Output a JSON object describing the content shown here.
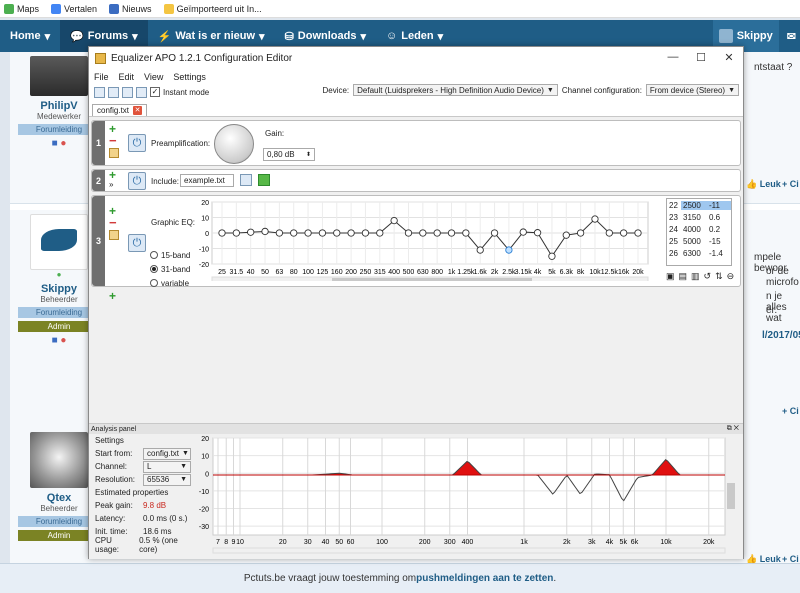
{
  "bookmarks": [
    "Maps",
    "Vertalen",
    "Nieuws",
    "Geïmporteerd uit In..."
  ],
  "forum_nav": {
    "items": [
      "Home",
      "Forums",
      "Wat is er nieuw",
      "Downloads",
      "Leden"
    ],
    "user": "Skippy"
  },
  "posts": [
    {
      "name": "PhilipV",
      "role": "Medewerker",
      "badge": "Forumleiding"
    },
    {
      "name": "Skippy",
      "role": "Beheerder",
      "badge1": "Forumleiding",
      "badge2": "Admin"
    },
    {
      "name": "Qtex",
      "role": "Beheerder",
      "badge1": "Forumleiding",
      "badge2": "Admin"
    }
  ],
  "right_snippets": [
    "ntstaat ?",
    "Leuk",
    "+ Ci",
    "mpele bewoor",
    "or de microfo",
    "n je alles wat",
    "er.",
    "l/2017/05/2",
    "+ Ci",
    "Leuk",
    "+ Ci"
  ],
  "notification": {
    "text": "Pctuts.be vraagt jouw toestemming om ",
    "link": "pushmeldingen aan te zetten",
    "end": " ."
  },
  "window": {
    "title": "Equalizer APO 1.2.1 Configuration Editor",
    "menu": [
      "File",
      "Edit",
      "View",
      "Settings"
    ],
    "instant_mode": "Instant mode",
    "device_label": "Device:",
    "device_value": "Default (Luidsprekers - High Definition Audio Device)",
    "channel_label": "Channel configuration:",
    "channel_value": "From device (Stereo)",
    "tab": "config.txt"
  },
  "blocks": {
    "b1": {
      "num": "1",
      "label": "Preamplification:",
      "gain_label": "Gain:",
      "gain_value": "0,80 dB"
    },
    "b2": {
      "num": "2",
      "label": "Include:",
      "include_value": "example.txt"
    },
    "b3": {
      "num": "3",
      "label": "Graphic EQ:",
      "r15": "15-band",
      "r31": "31-band",
      "rvar": "variable"
    }
  },
  "eq_table": [
    {
      "i": "22",
      "f": "2500",
      "g": "-11"
    },
    {
      "i": "23",
      "f": "3150",
      "g": "0.6"
    },
    {
      "i": "24",
      "f": "4000",
      "g": "0.2"
    },
    {
      "i": "25",
      "f": "5000",
      "g": "-15"
    },
    {
      "i": "26",
      "f": "6300",
      "g": "-1.4"
    }
  ],
  "eq_chart": {
    "y_ticks": [
      "20",
      "10",
      "0",
      "-10",
      "-20"
    ],
    "x_ticks": [
      "25",
      "31.5",
      "40",
      "50",
      "63",
      "80",
      "100",
      "125",
      "160",
      "200",
      "250",
      "315",
      "400",
      "500",
      "630",
      "800",
      "1k",
      "1.25k",
      "1.6k",
      "2k",
      "2.5k",
      "3.15k",
      "4k",
      "5k",
      "6.3k",
      "8k",
      "10k",
      "12.5k",
      "16k",
      "20k"
    ]
  },
  "chart_data": {
    "type": "line",
    "title": "",
    "xlabel": "",
    "ylabel": "",
    "x": [
      "25",
      "31.5",
      "40",
      "50",
      "63",
      "80",
      "100",
      "125",
      "160",
      "200",
      "250",
      "315",
      "400",
      "500",
      "630",
      "800",
      "1k",
      "1.25k",
      "1.6k",
      "2k",
      "2.5k",
      "3.15k",
      "4k",
      "5k",
      "6.3k",
      "8k",
      "10k",
      "12.5k",
      "16k",
      "20k"
    ],
    "values": [
      0,
      0,
      0.5,
      1,
      0,
      0,
      0,
      0,
      0,
      0,
      0,
      0,
      8,
      0,
      0,
      0,
      0,
      0,
      -11,
      0,
      -11,
      0.6,
      0.2,
      -15,
      -1.4,
      0,
      9,
      0,
      0,
      0
    ],
    "ylim": [
      -20,
      20
    ]
  },
  "analysis": {
    "title": "Analysis panel",
    "settings": "Settings",
    "start_from_label": "Start from:",
    "start_from_value": "config.txt",
    "channel_label": "Channel:",
    "channel_value": "L",
    "resolution_label": "Resolution:",
    "resolution_value": "65536",
    "est": "Estimated properties",
    "peak_label": "Peak gain:",
    "peak_value": "9.8 dB",
    "latency_label": "Latency:",
    "latency_value": "0.0 ms (0 s.)",
    "init_label": "Init. time:",
    "init_value": "18.6 ms",
    "cpu_label": "CPU usage:",
    "cpu_value": "0.5 % (one core)",
    "y_ticks": [
      "20",
      "10",
      "0",
      "-10",
      "-20",
      "-30"
    ],
    "x_ticks": [
      "7",
      "8",
      "9",
      "10",
      "20",
      "30",
      "40",
      "50",
      "60",
      "100",
      "200",
      "300",
      "400",
      "1k",
      "2k",
      "3k",
      "4k",
      "5k",
      "6k",
      "10k",
      "20k"
    ]
  }
}
